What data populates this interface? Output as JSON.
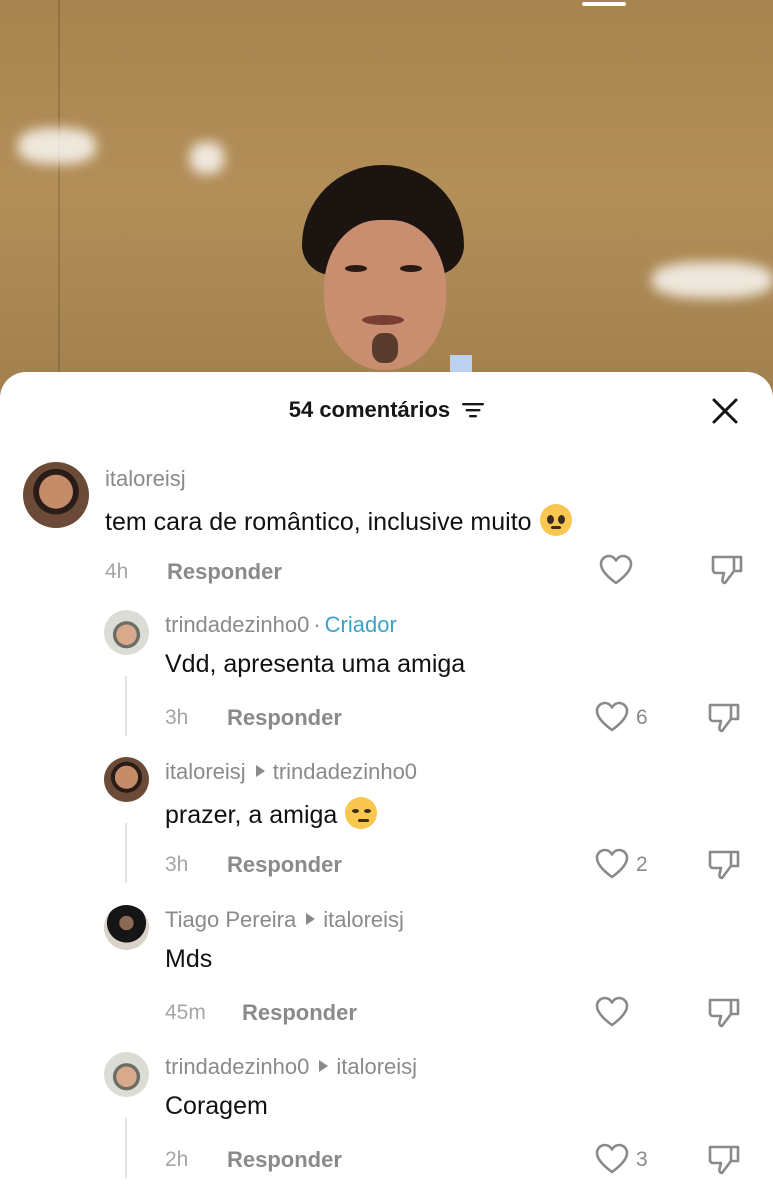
{
  "sheet": {
    "title": "54 comentários",
    "filter_icon": "filter-lines-icon",
    "close_icon": "close-icon"
  },
  "comments": [
    {
      "author": "italoreisj",
      "text": "tem cara de romântico, inclusive muito",
      "emoji": "pleading-face",
      "time": "4h",
      "reply_label": "Responder",
      "likes": ""
    },
    {
      "author": "trindadezinho0",
      "badge": "Criador",
      "separator": "·",
      "text": "Vdd, apresenta uma amiga",
      "time": "3h",
      "reply_label": "Responder",
      "likes": "6"
    },
    {
      "author": "italoreisj",
      "reply_to": "trindadezinho0",
      "text": "prazer, a amiga",
      "emoji": "smirking-face",
      "time": "3h",
      "reply_label": "Responder",
      "likes": "2"
    },
    {
      "author": "Tiago Pereira",
      "reply_to": "italoreisj",
      "text": "Mds",
      "time": "45m",
      "reply_label": "Responder",
      "likes": ""
    },
    {
      "author": "trindadezinho0",
      "reply_to": "italoreisj",
      "text": "Coragem",
      "time": "2h",
      "reply_label": "Responder",
      "likes": "3"
    }
  ],
  "colors": {
    "creator_badge": "#3aa3c8",
    "meta_gray": "#8a8a8a",
    "sheet_bg": "#ffffff"
  }
}
